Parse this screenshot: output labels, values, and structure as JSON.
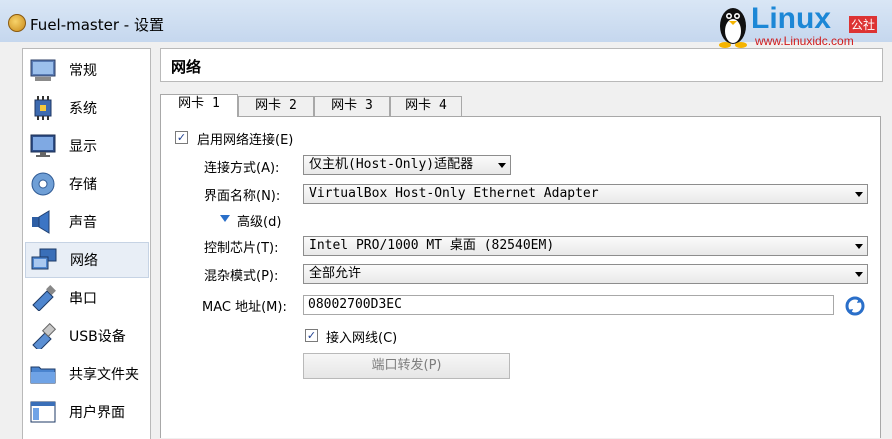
{
  "window": {
    "title": "Fuel-master - 设置"
  },
  "watermark": {
    "brand": "Linux",
    "tag": "公社",
    "url": "www.Linuxidc.com"
  },
  "sidebar": {
    "items": [
      {
        "label": "常规",
        "icon": "general-icon"
      },
      {
        "label": "系统",
        "icon": "system-chip-icon"
      },
      {
        "label": "显示",
        "icon": "display-icon"
      },
      {
        "label": "存储",
        "icon": "storage-icon"
      },
      {
        "label": "声音",
        "icon": "speaker-icon"
      },
      {
        "label": "网络",
        "icon": "network-icon"
      },
      {
        "label": "串口",
        "icon": "serial-port-icon"
      },
      {
        "label": "USB设备",
        "icon": "usb-icon"
      },
      {
        "label": "共享文件夹",
        "icon": "folder-icon"
      },
      {
        "label": "用户界面",
        "icon": "user-interface-icon"
      }
    ],
    "selected": "网络"
  },
  "header": {
    "title": "网络"
  },
  "tabs": [
    {
      "label": "网卡 1",
      "active": true
    },
    {
      "label": "网卡 2",
      "active": false
    },
    {
      "label": "网卡 3",
      "active": false
    },
    {
      "label": "网卡 4",
      "active": false
    }
  ],
  "form": {
    "enable_adapter": {
      "label": "启用网络连接(E)",
      "checked": true
    },
    "attached_to": {
      "label": "连接方式(A):",
      "value": "仅主机(Host-Only)适配器"
    },
    "name": {
      "label": "界面名称(N):",
      "value": "VirtualBox Host-Only Ethernet Adapter"
    },
    "advanced": {
      "label": "高级(d)"
    },
    "adapter_type": {
      "label": "控制芯片(T):",
      "value": "Intel PRO/1000 MT 桌面 (82540EM)"
    },
    "promiscuous": {
      "label": "混杂模式(P):",
      "value": "全部允许"
    },
    "mac": {
      "label": "MAC 地址(M):",
      "value": "08002700D3EC"
    },
    "cable": {
      "label": "接入网线(C)",
      "checked": true
    },
    "port_forward": {
      "label": "端口转发(P)"
    }
  },
  "colors": {
    "selection": "#e8eef6",
    "accent_blue": "#2a6fc9",
    "disabled_text": "#7d7d7d"
  }
}
